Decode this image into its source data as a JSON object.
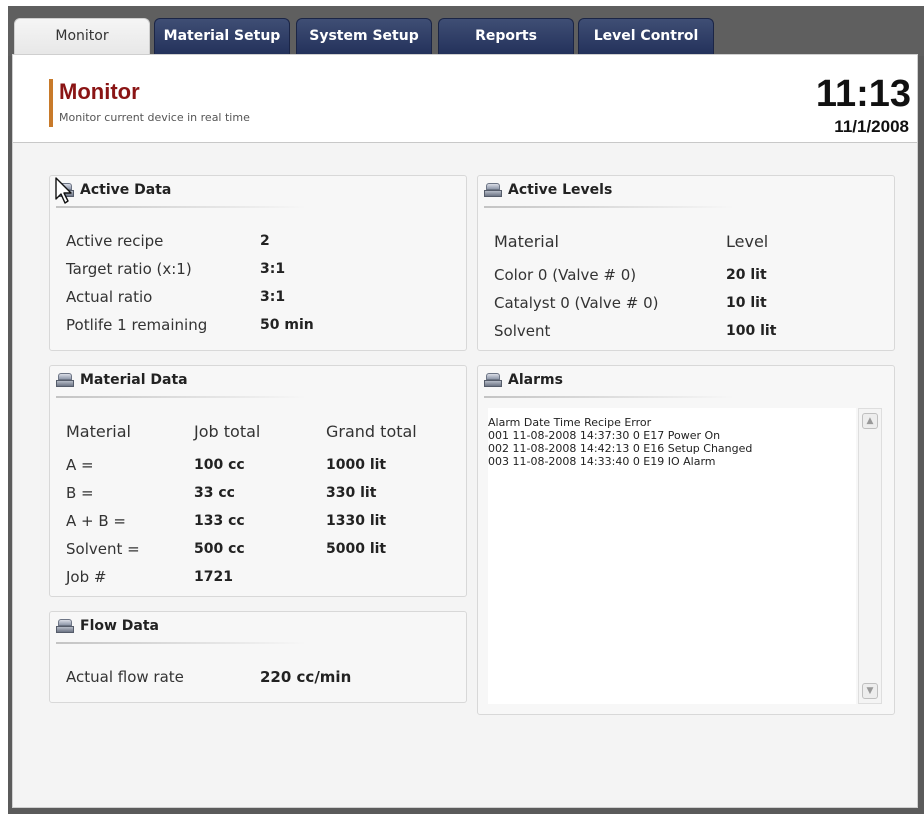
{
  "tabs": [
    "Monitor",
    "Material Setup",
    "System Setup",
    "Reports",
    "Level Control"
  ],
  "header": {
    "title": "Monitor",
    "subtitle": "Monitor current device in real time",
    "time": "11:13",
    "date": "11/1/2008"
  },
  "active_data": {
    "title": "Active Data",
    "rows": [
      {
        "label": "Active recipe",
        "value": "2"
      },
      {
        "label": "Target ratio (x:1)",
        "value": "3:1"
      },
      {
        "label": "Actual ratio",
        "value": "3:1"
      },
      {
        "label": "Potlife 1 remaining",
        "value": "50 min"
      }
    ]
  },
  "material_data": {
    "title": "Material Data",
    "headers": [
      "Material",
      "Job total",
      "Grand total"
    ],
    "rows": [
      [
        "A =",
        "100 cc",
        "1000 lit"
      ],
      [
        "B =",
        "33 cc",
        "330 lit"
      ],
      [
        "A + B =",
        "133 cc",
        "1330 lit"
      ],
      [
        "Solvent =",
        "500 cc",
        "5000 lit"
      ],
      [
        "Job #",
        "1721",
        ""
      ]
    ]
  },
  "flow_data": {
    "title": "Flow Data",
    "label": "Actual flow rate",
    "value": "220 cc/min"
  },
  "active_levels": {
    "title": "Active Levels",
    "headers": [
      "Material",
      "Level"
    ],
    "rows": [
      [
        "Color 0 (Valve # 0)",
        "20 lit"
      ],
      [
        "Catalyst 0 (Valve # 0)",
        "10 lit"
      ],
      [
        "Solvent",
        "100 lit"
      ]
    ]
  },
  "alarms": {
    "title": "Alarms",
    "lines": [
      "Alarm Date Time Recipe Error",
      "001 11-08-2008 14:37:30 0 E17 Power On",
      "002 11-08-2008 14:42:13 0 E16 Setup Changed",
      "003 11-08-2008 14:33:40 0 E19 IO Alarm"
    ]
  }
}
